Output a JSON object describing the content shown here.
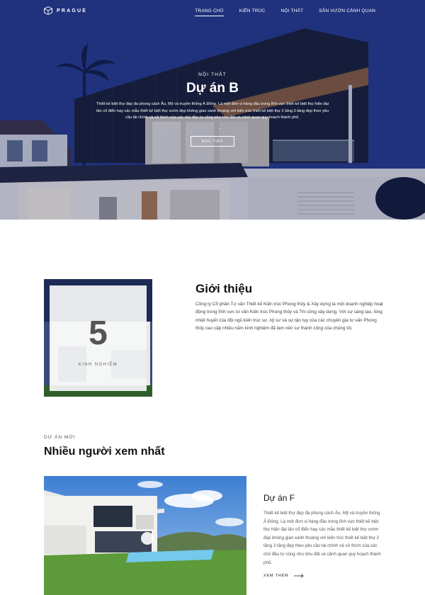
{
  "brand": {
    "name": "PRAGUE"
  },
  "nav": {
    "items": [
      {
        "label": "TRANG CHỦ",
        "active": true
      },
      {
        "label": "KIẾN TRÚC",
        "active": false
      },
      {
        "label": "NỘI THẤT",
        "active": false
      },
      {
        "label": "SÂN VƯỜN CẢNH QUAN",
        "active": false
      }
    ]
  },
  "hero": {
    "eyebrow": "NỘI THẤT",
    "title": "Dự án B",
    "description": "Thiết kế biệt thự đẹp đa phong cách Âu, Mỹ và truyền thống Á Đông. Là một đơn vị hàng đầu trong lĩnh vực thiết kế biệt thự hiện đại tân cổ điển hay các mẫu thiết kế biệt thự vườn đẹp không gian xanh thoáng với kiến trúc thiết kế biệt thự 2 tầng 3 tầng đẹp theo yêu cầu tài chính và sở thích của các chủ đầu tư cũng như khu đất và cảnh quan quy hoạch thành phố.",
    "button": "ĐỌC TIẾP"
  },
  "intro": {
    "stat_number": "5",
    "stat_label": "KINH NGHIỆM",
    "title": "Giới thiệu",
    "text": "Công ty Cổ phần Tư vấn Thiết kế Kiến trúc Phong thủy & Xây dựng là một doanh nghiệp hoạt động trong lĩnh vực tư vấn Kiến trúc Phong thủy và Thi công xây dựng. Với sự sáng tạo, lòng nhiệt huyết của đội ngũ kiến trúc sư, kỹ sư và sự tận tụy của các chuyên gia tư vấn Phong thủy cao cấp nhiều năm kinh nghiệm đã làm nên sự thành công của chúng tôi."
  },
  "projects": {
    "eyebrow": "DỰ ÁN MỚI",
    "title": "Nhiều người xem nhất",
    "items": [
      {
        "title": "Dự án F",
        "description": "Thiết kế biệt thự đẹp đa phong cách Âu, Mỹ và truyền thống Á Đông. Là một đơn vị hàng đầu trong lĩnh vực thiết kế biệt thự hiện đại tân cổ điển hay các mẫu thiết kế biệt thự vườn đẹp không gian xanh thoáng với kiến trúc thiết kế biệt thự 2 tầng 3 tầng đẹp theo yêu cầu tài chính và sở thích của các chủ đầu tư cũng như khu đất và cảnh quan quy hoạch thành phố.",
        "more": "XEM THÊM"
      }
    ]
  },
  "icons": {
    "logo": "cube-logo-icon",
    "more": "arrow-right-icon"
  },
  "colors": {
    "hero_tint": "#2a3f94",
    "text_dark": "#111111",
    "text_muted": "#555555"
  }
}
